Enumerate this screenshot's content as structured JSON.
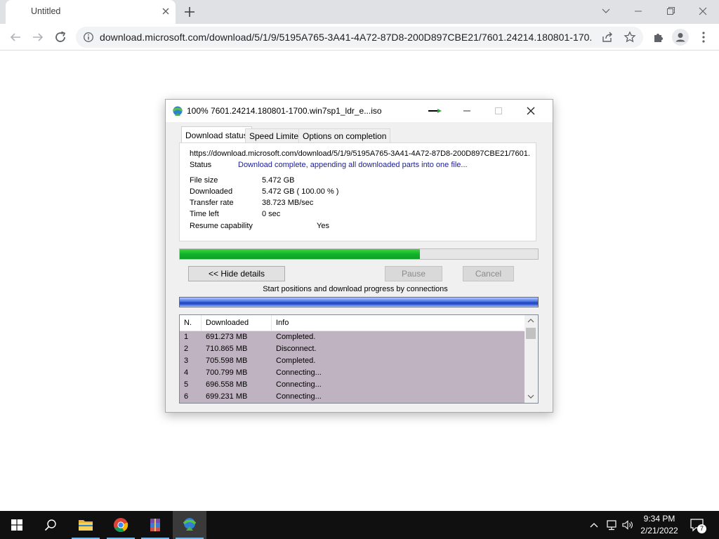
{
  "browser": {
    "tab_title": "Untitled",
    "url": "download.microsoft.com/download/5/1/9/5195A765-3A41-4A72-87D8-200D897CBE21/7601.24214.180801-170..."
  },
  "dialog": {
    "title": "100% 7601.24214.180801-1700.win7sp1_ldr_e...iso",
    "tabs": [
      "Download status",
      "Speed Limiter",
      "Options on completion"
    ],
    "active_tab": "Download status",
    "url_line": "https://download.microsoft.com/download/5/1/9/5195A765-3A41-4A72-87D8-200D897CBE21/7601.",
    "status_label": "Status",
    "status_value": "Download complete, appending all downloaded parts into one file...",
    "info": {
      "file_size_label": "File size",
      "file_size": "5.472  GB",
      "downloaded_label": "Downloaded",
      "downloaded": "5.472  GB  ( 100.00 % )",
      "transfer_rate_label": "Transfer rate",
      "transfer_rate": "38.723  MB/sec",
      "time_left_label": "Time left",
      "time_left": "0 sec",
      "resume_label": "Resume capability",
      "resume": "Yes"
    },
    "progress_fraction": 0.67,
    "buttons": {
      "hide_details": "<< Hide details",
      "pause": "Pause",
      "cancel": "Cancel"
    },
    "connections_caption": "Start positions and download progress by connections",
    "columns": [
      "N.",
      "Downloaded",
      "Info"
    ],
    "connections": [
      {
        "n": "1",
        "downloaded": "691.273  MB",
        "info": "Completed."
      },
      {
        "n": "2",
        "downloaded": "710.865  MB",
        "info": "Disconnect."
      },
      {
        "n": "3",
        "downloaded": "705.598  MB",
        "info": "Completed."
      },
      {
        "n": "4",
        "downloaded": "700.799  MB",
        "info": "Connecting..."
      },
      {
        "n": "5",
        "downloaded": "696.558  MB",
        "info": "Connecting..."
      },
      {
        "n": "6",
        "downloaded": "699.231  MB",
        "info": "Connecting..."
      }
    ]
  },
  "taskbar": {
    "time": "9:34 PM",
    "date": "2/21/2022",
    "notification_count": "7"
  },
  "colors": {
    "progress_green": "#12b32a",
    "status_text": "#1c1c9c",
    "row_highlight": "#c0b3c1",
    "taskbar": "#101010"
  }
}
